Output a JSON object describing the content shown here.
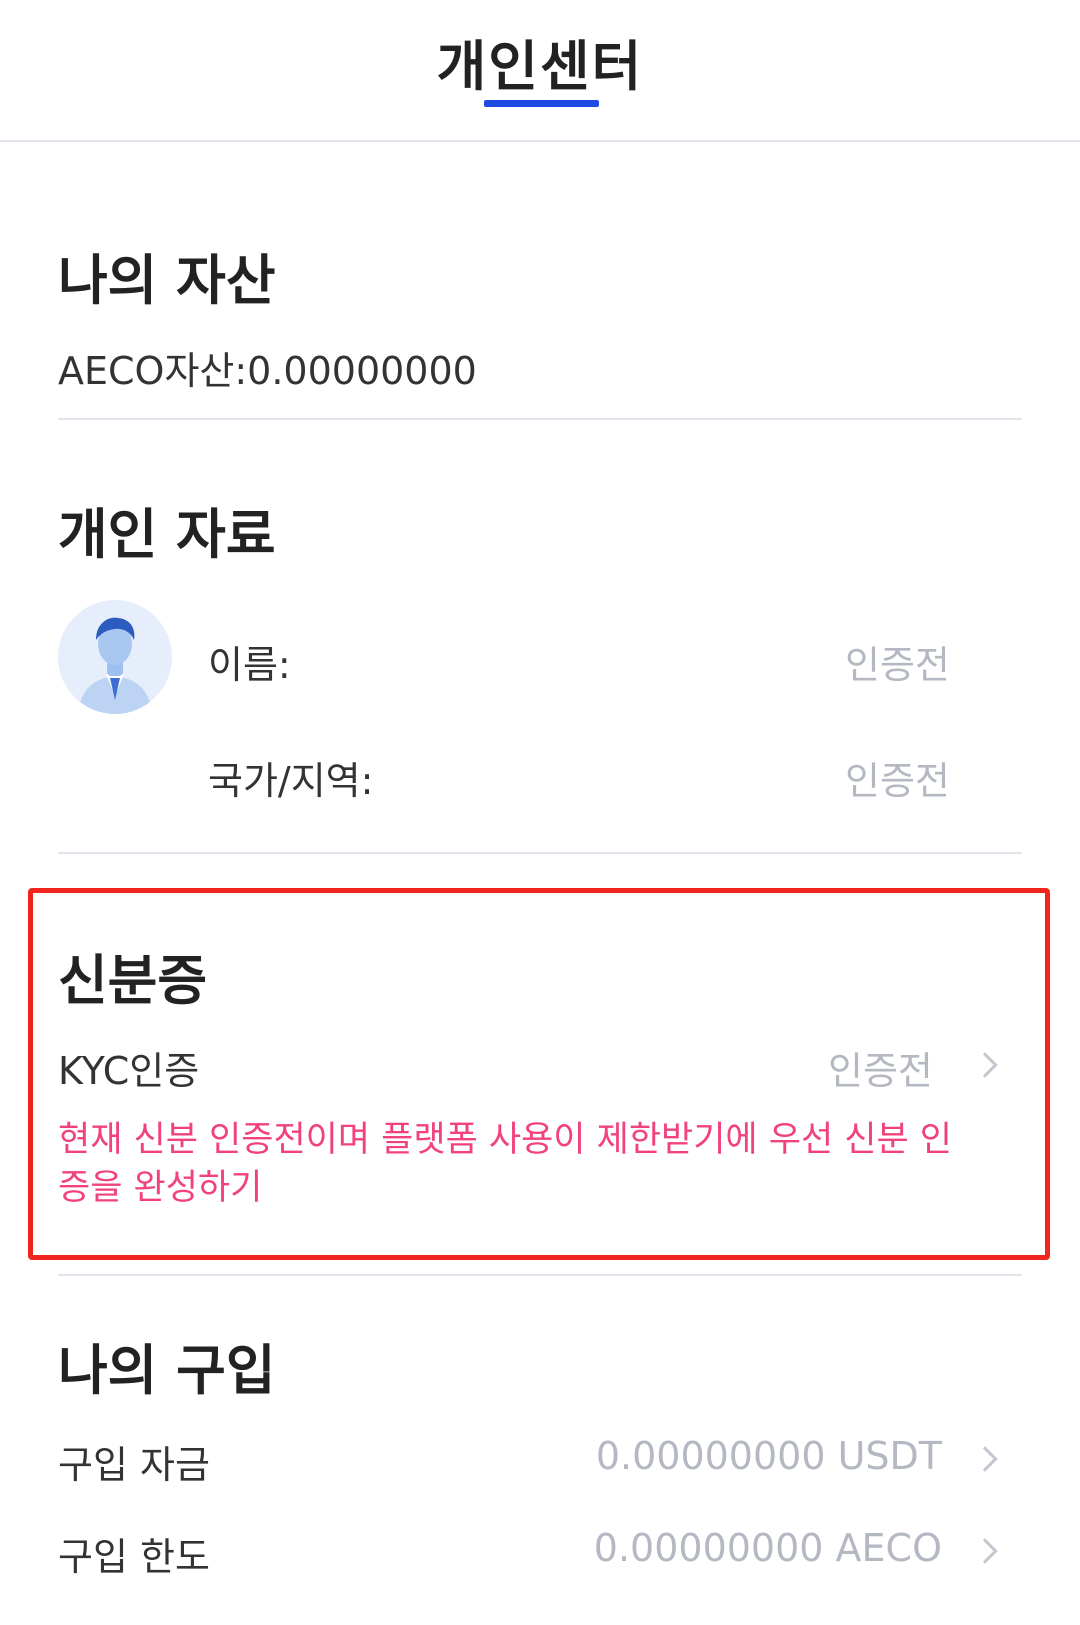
{
  "header": {
    "title": "개인센터"
  },
  "assets": {
    "title": "나의 자산",
    "balance_text": "AECO자산:0.00000000"
  },
  "profile": {
    "title": "개인 자료",
    "name_label": "이름:",
    "name_value": "인증전",
    "region_label": "국가/지역:",
    "region_value": "인증전"
  },
  "identity": {
    "title": "신분증",
    "kyc_label": "KYC인증",
    "kyc_value": "인증전",
    "warning": "현재 신분 인증전이며 플랫폼 사용이 제한받기에 우선 신분 인증을 완성하기",
    "highlight_color": "#f0251d",
    "warning_color": "#f1427a"
  },
  "purchase": {
    "title": "나의 구입",
    "funds_label": "구입 자금",
    "funds_value": "0.00000000 USDT",
    "limit_label": "구입 한도",
    "limit_value": "0.00000000 AECO"
  },
  "icons": {
    "chevron": "chevron-right-icon",
    "avatar": "user-avatar-icon"
  },
  "colors": {
    "accent": "#1f4be3",
    "muted": "#b4b8c2"
  }
}
